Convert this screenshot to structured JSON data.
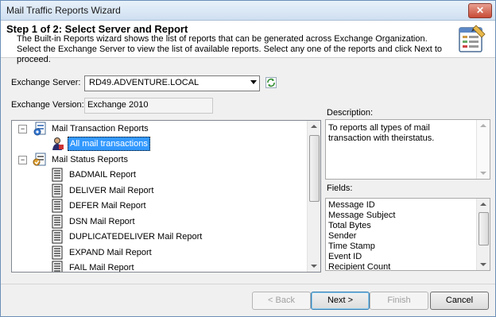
{
  "window": {
    "title": "Mail Traffic Reports Wizard",
    "close_glyph": "✕"
  },
  "header": {
    "step": "Step 1 of 2:  Select Server and Report",
    "description": "The Built-in Reports wizard shows the list of reports that can be generated across Exchange Organization. Select the Exchange Server to view the list of available reports. Select any one of the reports and click Next to proceed."
  },
  "server": {
    "label": "Exchange Server:",
    "value": "RD49.ADVENTURE.LOCAL"
  },
  "version": {
    "label": "Exchange Version:",
    "value": "Exchange 2010"
  },
  "tree": {
    "groups": [
      {
        "label": "Mail Transaction Reports",
        "items": [
          "All mail transactions"
        ]
      },
      {
        "label": "Mail Status Reports",
        "items": [
          "BADMAIL Report",
          "DELIVER Mail Report",
          "DEFER Mail Report",
          "DSN Mail Report",
          "DUPLICATEDELIVER Mail Report",
          "EXPAND Mail Report",
          "FAIL Mail Report"
        ]
      }
    ],
    "selected": "All mail transactions"
  },
  "description_panel": {
    "label": "Description:",
    "text": "To reports all types of mail transaction with theirstatus."
  },
  "fields_panel": {
    "label": "Fields:",
    "items": [
      "Message ID",
      "Message Subject",
      "Total Bytes",
      "Sender",
      "Time Stamp",
      "Event ID",
      "Recipient Count"
    ]
  },
  "buttons": {
    "back": "< Back",
    "next": "Next >",
    "finish": "Finish",
    "cancel": "Cancel"
  },
  "colors": {
    "selection": "#3399ff",
    "title_gradient": "#cfdff0"
  },
  "icons": [
    "close-icon",
    "wizard-report-icon",
    "refresh-icon",
    "mail-transaction-icon",
    "user-report-icon",
    "mail-status-icon",
    "document-icon"
  ]
}
